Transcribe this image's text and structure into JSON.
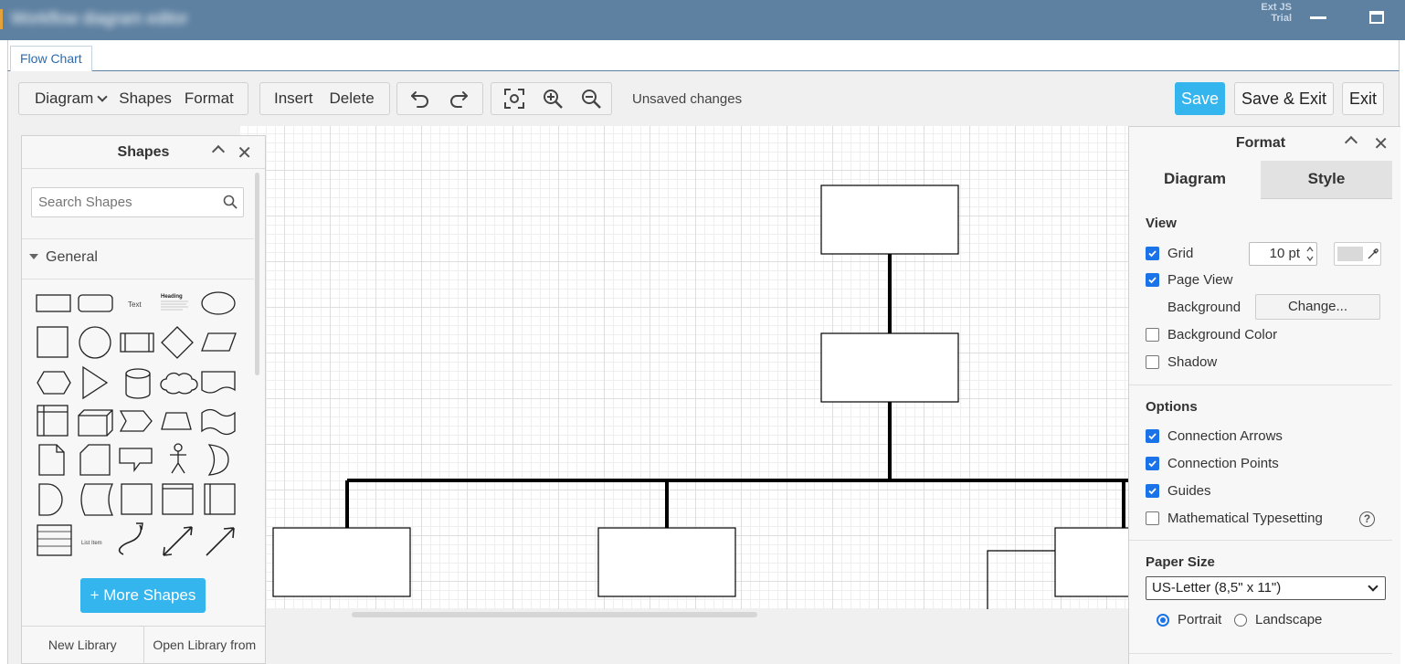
{
  "window": {
    "title": "Workflow diagram editor",
    "ext_badge": "Ext JS Trial"
  },
  "tabs": [
    {
      "label": "Flow Chart"
    }
  ],
  "toolbar": {
    "diagram": "Diagram",
    "shapes": "Shapes",
    "format": "Format",
    "insert": "Insert",
    "delete": "Delete",
    "status": "Unsaved changes",
    "save": "Save",
    "save_exit": "Save & Exit",
    "exit": "Exit"
  },
  "shapes_panel": {
    "title": "Shapes",
    "search_placeholder": "Search Shapes",
    "group": "General",
    "text_shape_label": "Text",
    "heading_shape_label": "Heading",
    "list_item_label": "List Item",
    "more_shapes": "More Shapes",
    "new_library": "New Library",
    "open_library": "Open Library from"
  },
  "format_panel": {
    "title": "Format",
    "tabs": [
      "Diagram",
      "Style"
    ],
    "view_title": "View",
    "grid_label": "Grid",
    "grid_size": "10 pt",
    "page_view_label": "Page View",
    "background_label": "Background",
    "change_button": "Change...",
    "background_color_label": "Background Color",
    "shadow_label": "Shadow",
    "options_title": "Options",
    "connection_arrows": "Connection Arrows",
    "connection_points": "Connection Points",
    "guides": "Guides",
    "math_typesetting": "Mathematical Typesetting",
    "help": "?",
    "paper_size_title": "Paper Size",
    "paper_size_value": "US-Letter (8,5\" x 11\")",
    "portrait": "Portrait",
    "landscape": "Landscape",
    "checks": {
      "grid": true,
      "page_view": true,
      "background_color": false,
      "shadow": false,
      "connection_arrows": true,
      "connection_points": true,
      "guides": true,
      "math_typesetting": false
    },
    "orientation": "portrait"
  },
  "colors": {
    "titlebar": "#5e81a1",
    "accent": "#35b5ee",
    "checkbox": "#1a73e8"
  }
}
